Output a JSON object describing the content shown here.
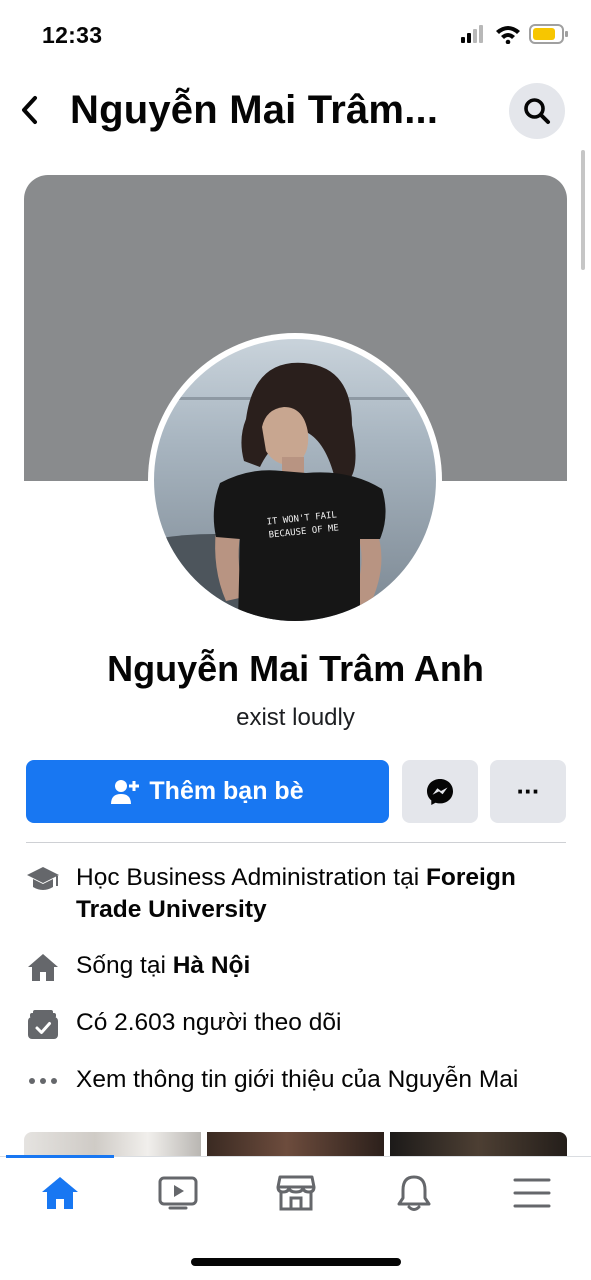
{
  "status_bar": {
    "time": "12:33",
    "icons": [
      "cellular-signal",
      "wifi",
      "battery-low"
    ]
  },
  "header": {
    "title": "Nguyễn Mai Trâm...",
    "back_icon": "chevron-left-icon",
    "search_icon": "search-icon"
  },
  "profile": {
    "name": "Nguyễn Mai Trâm Anh",
    "bio": "exist loudly",
    "cover_color": "#898b8d",
    "shirt_text_line1": "IT WON'T FAIL",
    "shirt_text_line2": "BECAUSE OF ME"
  },
  "actions": {
    "add_friend_label": "Thêm bạn bè",
    "add_friend_icon": "person-add-icon",
    "messenger_icon": "messenger-icon",
    "more_label": "···",
    "accent_color": "#1877f2"
  },
  "details": {
    "education": {
      "icon": "graduation-cap-icon",
      "prefix": "Học Business Administration tại ",
      "school": "Foreign Trade University"
    },
    "lives_in": {
      "icon": "home-icon",
      "prefix": "Sống tại ",
      "place": "Hà Nội"
    },
    "followers": {
      "icon": "followers-icon",
      "text": "Có 2.603 người theo dõi"
    },
    "see_about": {
      "icon": "ellipsis-icon",
      "text": "Xem thông tin giới thiệu của Nguyễn Mai"
    }
  },
  "tabbar": {
    "tabs": [
      {
        "icon": "home-icon",
        "active": true
      },
      {
        "icon": "video-icon",
        "active": false
      },
      {
        "icon": "marketplace-icon",
        "active": false
      },
      {
        "icon": "bell-icon",
        "active": false
      },
      {
        "icon": "menu-icon",
        "active": false
      }
    ]
  }
}
